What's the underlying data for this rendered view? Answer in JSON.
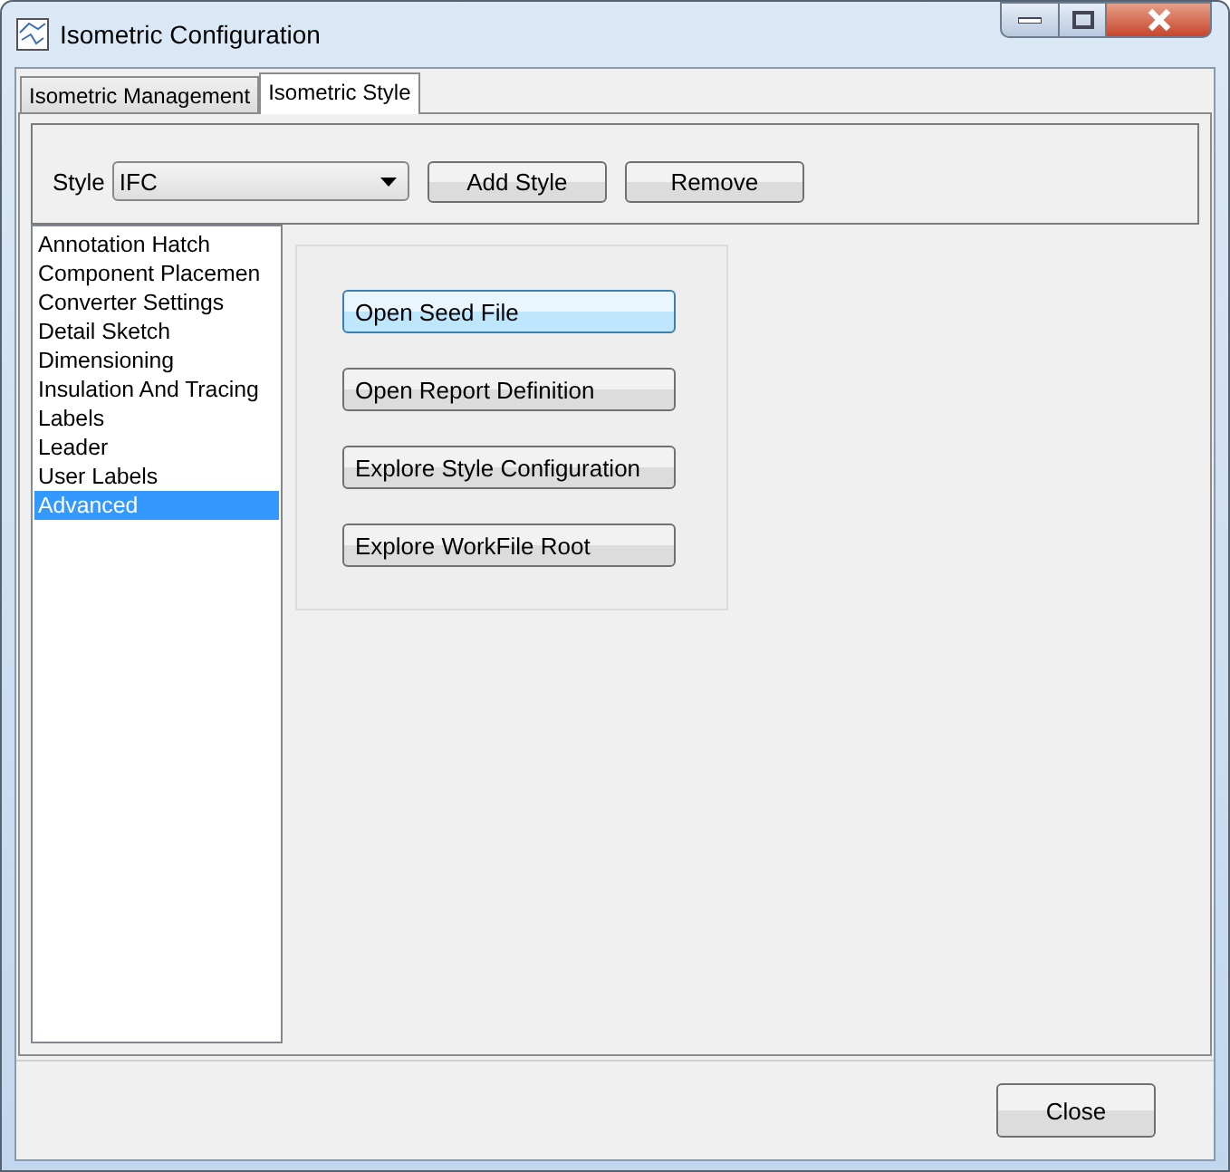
{
  "window": {
    "title": "Isometric Configuration"
  },
  "tabs": [
    {
      "label": "Isometric Management",
      "selected": false
    },
    {
      "label": "Isometric Style",
      "selected": true
    }
  ],
  "style": {
    "label": "Style",
    "value": "IFC",
    "buttons": [
      "Add Style",
      "Remove"
    ]
  },
  "sidebar": {
    "items": [
      {
        "label": "Annotation Hatch",
        "selected": false
      },
      {
        "label": "Component Placemen",
        "selected": false
      },
      {
        "label": "Converter Settings",
        "selected": false
      },
      {
        "label": "Detail Sketch",
        "selected": false
      },
      {
        "label": "Dimensioning",
        "selected": false
      },
      {
        "label": "Insulation And Tracing",
        "selected": false
      },
      {
        "label": "Labels",
        "selected": false
      },
      {
        "label": "Leader",
        "selected": false
      },
      {
        "label": "User Labels",
        "selected": false
      },
      {
        "label": "Advanced",
        "selected": true
      }
    ]
  },
  "actions": [
    {
      "label": "Open Seed File",
      "focused": true
    },
    {
      "label": "Open Report Definition",
      "focused": false
    },
    {
      "label": "Explore Style Configuration",
      "focused": false
    },
    {
      "label": "Explore WorkFile Root",
      "focused": false
    }
  ],
  "footer": {
    "button": "Close"
  }
}
